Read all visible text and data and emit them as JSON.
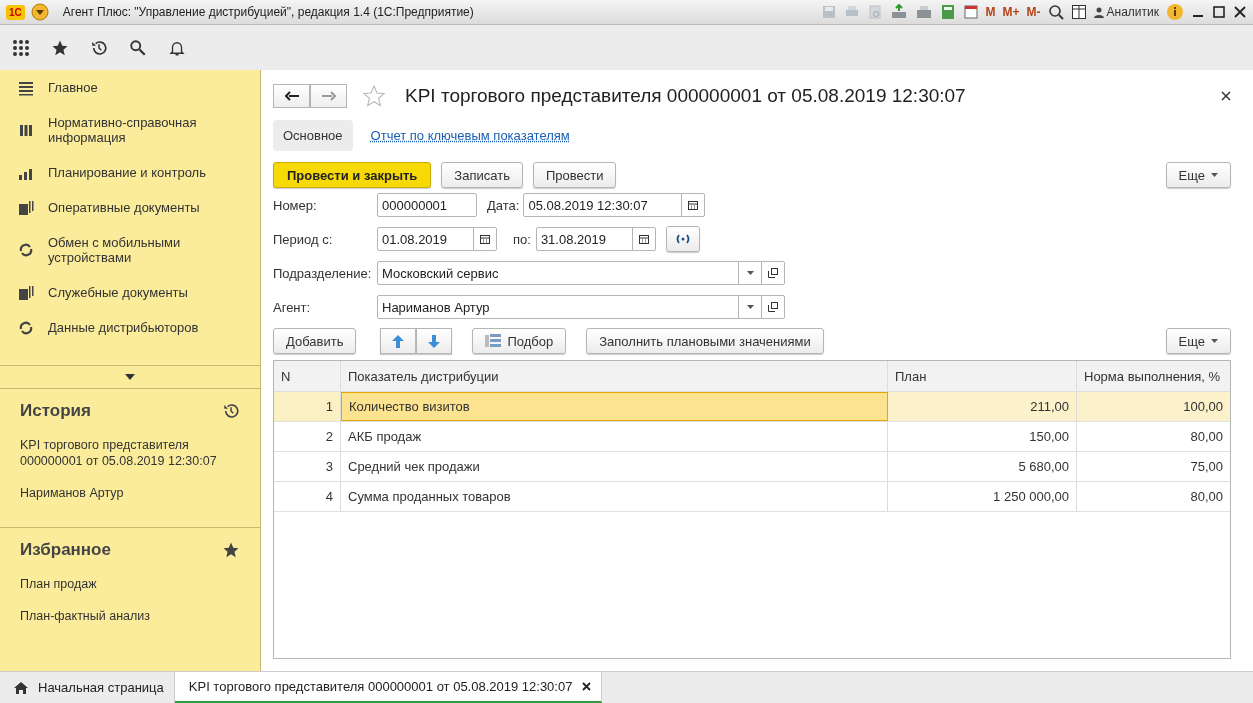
{
  "window": {
    "title": "Агент Плюс: \"Управление дистрибуцией\", редакция 1.4  (1С:Предприятие)",
    "logo": "1С",
    "memory_buttons": [
      "M",
      "M+",
      "M-"
    ],
    "user": "Аналитик"
  },
  "sidebar": {
    "sections": [
      {
        "label": "Главное",
        "kind": "lines"
      },
      {
        "label": "Нормативно-справочная информация",
        "kind": "grid"
      },
      {
        "label": "Планирование и контроль",
        "kind": "bars"
      },
      {
        "label": "Оперативные документы",
        "kind": "docs"
      },
      {
        "label": "Обмен с мобильными устройствами",
        "kind": "sync"
      },
      {
        "label": "Служебные документы",
        "kind": "docs"
      },
      {
        "label": "Данные дистрибьюторов",
        "kind": "sync"
      }
    ],
    "history": {
      "title": "История",
      "items": [
        "KPI торгового представителя 000000001 от 05.08.2019 12:30:07",
        "Нариманов Артур"
      ]
    },
    "favorites": {
      "title": "Избранное",
      "items": [
        "План продаж",
        "План-фактный анализ"
      ]
    }
  },
  "form": {
    "title": "KPI торгового представителя 000000001 от 05.08.2019 12:30:07",
    "favorite": false,
    "tabs": [
      {
        "label": "Основное",
        "selected": true
      },
      {
        "label": "Отчет по ключевым показателям",
        "selected": false
      }
    ],
    "buttons": [
      "Провести и закрыть",
      "Записать",
      "Провести"
    ],
    "more": "Еще",
    "number": {
      "label": "Номер:",
      "value": "000000001"
    },
    "date": {
      "label": "Дата:",
      "value": "05.08.2019 12:30:07"
    },
    "period": {
      "label": "Период с:",
      "from": "01.08.2019",
      "to_label": "по:",
      "to": "31.08.2019"
    },
    "department": {
      "label": "Подразделение:",
      "value": "Московский сервис"
    },
    "agent": {
      "label": "Агент:",
      "value": "Нариманов Артур"
    },
    "table_buttons": {
      "add": "Добавить",
      "pick": "Подбор",
      "fill": "Заполнить плановыми значениями",
      "more": "Еще"
    },
    "table": {
      "columns": [
        "N",
        "Показатель дистрибуции",
        "План",
        "Норма выполнения, %"
      ],
      "rows": [
        {
          "n": "1",
          "name": "Количество визитов",
          "plan": "211,00",
          "norm": "100,00",
          "selected": true
        },
        {
          "n": "2",
          "name": "АКБ продаж",
          "plan": "150,00",
          "norm": "80,00",
          "selected": false
        },
        {
          "n": "3",
          "name": "Средний чек продажи",
          "plan": "5 680,00",
          "norm": "75,00",
          "selected": false
        },
        {
          "n": "4",
          "name": "Сумма проданных товаров",
          "plan": "1 250 000,00",
          "norm": "80,00",
          "selected": false
        }
      ]
    }
  },
  "bottom_tabs": [
    {
      "label": "Начальная страница",
      "kind": "home",
      "selected": false
    },
    {
      "label": "KPI торгового представителя 000000001 от 05.08.2019 12:30:07",
      "kind": "doc",
      "selected": true
    }
  ]
}
